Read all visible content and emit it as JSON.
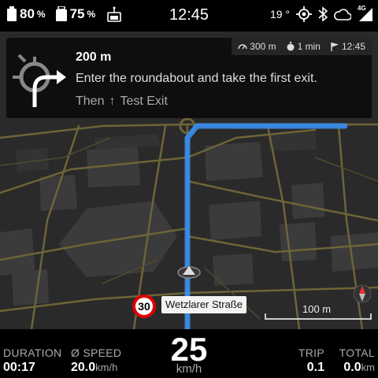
{
  "status": {
    "battery1_value": "80",
    "battery1_unit": "%",
    "battery2_value": "75",
    "battery2_unit": "%",
    "time": "12:45",
    "temperature": "19 °",
    "network": "4G"
  },
  "instruction": {
    "distance": "200 m",
    "text": "Enter the roundabout and take the first exit.",
    "then_label": "Then",
    "then_arrow": "↑",
    "then_text": "Test Exit",
    "eta": {
      "remaining_distance": "300 m",
      "remaining_time": "1 min",
      "arrival_time": "12:45"
    }
  },
  "map": {
    "speed_limit": "30",
    "street_name": "Wetzlarer Straße",
    "scale_label": "100 m",
    "route_color": "#3a8ef0"
  },
  "dashboard": {
    "duration_label": "DURATION",
    "duration_value": "00:17",
    "avg_speed_label": "Ø SPEED",
    "avg_speed_value": "20.0",
    "avg_speed_unit": "km/h",
    "speed_value": "25",
    "speed_unit": "km/h",
    "trip_label": "TRIP",
    "trip_value": "0.1",
    "total_label": "TOTAL",
    "total_value": "0.0",
    "total_unit": "km"
  }
}
